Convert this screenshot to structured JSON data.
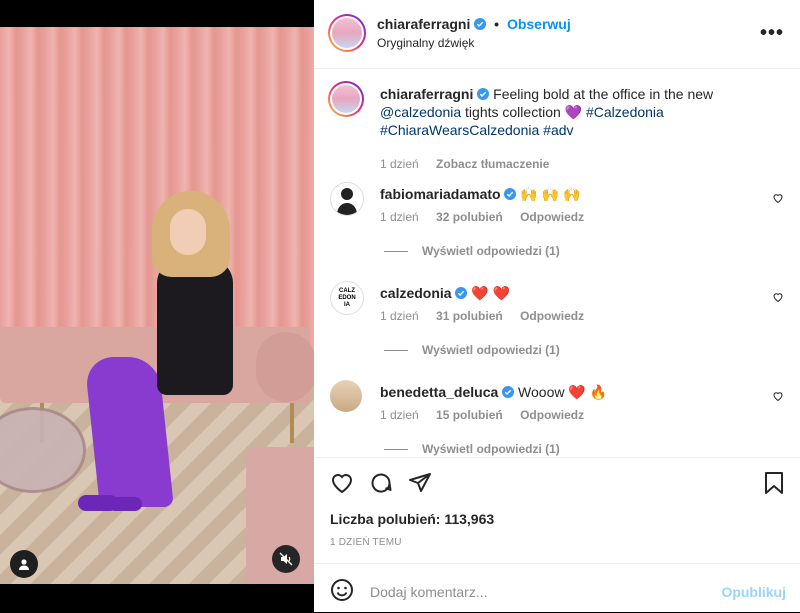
{
  "post": {
    "author": "chiaraferragni",
    "follow_label": "Obserwuj",
    "audio": "Oryginalny dźwięk",
    "caption_text": "Feeling bold at the office in the new",
    "caption_mention": "@calzedonia",
    "caption_text2": "tights collection",
    "caption_emoji": "💜",
    "caption_tag1": "#Calzedonia",
    "caption_tag2": "#ChiaraWearsCalzedonia",
    "caption_tag3": "#adv",
    "caption_time": "1 dzień",
    "translate_label": "Zobacz tłumaczenie",
    "likes": "Liczba polubień: 113,963",
    "posted_ago": "1 DZIEŃ TEMU",
    "comment_placeholder": "Dodaj komentarz...",
    "publish_label": "Opublikuj"
  },
  "comments": [
    {
      "user": "fabiomariadamato",
      "text": "🙌 🙌 🙌",
      "time": "1 dzień",
      "likes": "32 polubień",
      "reply": "Odpowiedz",
      "view_replies": "Wyświetl odpowiedzi (1)"
    },
    {
      "user": "calzedonia",
      "text": "❤️ ❤️",
      "time": "1 dzień",
      "likes": "31 polubień",
      "reply": "Odpowiedz",
      "view_replies": "Wyświetl odpowiedzi (1)"
    },
    {
      "user": "benedetta_deluca",
      "text": "Wooow ❤️ 🔥",
      "time": "1 dzień",
      "likes": "15 polubień",
      "reply": "Odpowiedz",
      "view_replies": "Wyświetl odpowiedzi (1)"
    }
  ],
  "avatars": {
    "calzedonia_logo": "CALZEDONIA"
  },
  "colors": {
    "accent": "#0095f6",
    "verified": "#3897f0",
    "muted": "#8e8e8e",
    "tights": "#8a3bcf"
  },
  "icons": [
    "more-icon",
    "heart-icon",
    "comment-icon",
    "share-icon",
    "bookmark-icon",
    "emoji-icon",
    "user-tag-icon",
    "mute-icon",
    "verified-icon"
  ]
}
